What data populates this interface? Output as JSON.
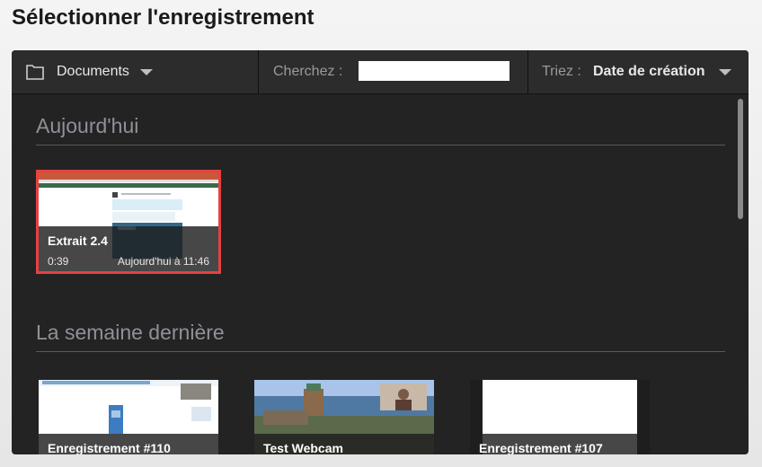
{
  "dialog": {
    "title": "Sélectionner l'enregistrement"
  },
  "toolbar": {
    "folder_label": "Documents",
    "search_label": "Cherchez :",
    "search_value": "",
    "sort_label": "Triez :",
    "sort_value": "Date de création"
  },
  "sections": [
    {
      "title": "Aujourd'hui",
      "items": [
        {
          "title": "Extrait 2.4",
          "duration": "0:39",
          "date": "Aujourd'hui à 11:46",
          "selected": true
        }
      ]
    },
    {
      "title": "La semaine dernière",
      "items": [
        {
          "title": "Enregistrement #110"
        },
        {
          "title": "Test Webcam"
        },
        {
          "title": "Enregistrement #107"
        }
      ]
    }
  ],
  "colors": {
    "selection": "#e84040",
    "panel": "#232323",
    "toolbar": "#2c2c2c"
  }
}
